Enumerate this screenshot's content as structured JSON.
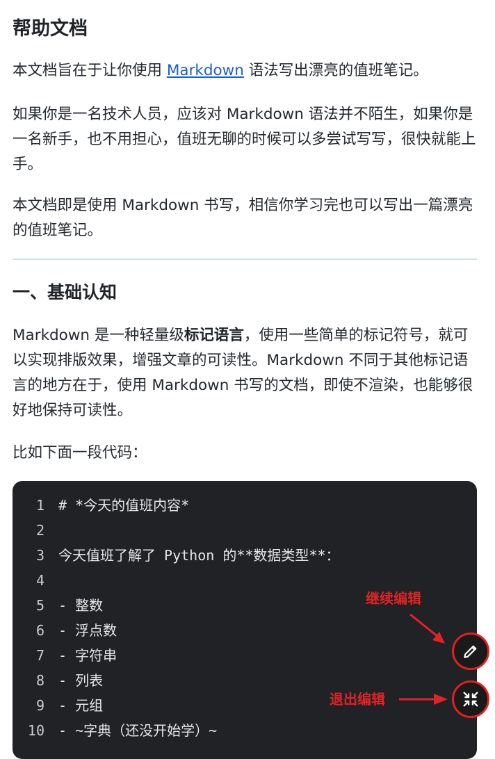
{
  "doc": {
    "title": "帮助文档",
    "intro_pre": "本文档旨在于让你使用 ",
    "intro_link": "Markdown",
    "intro_post": " 语法写出漂亮的值班笔记。",
    "para2": "如果你是一名技术人员，应该对 Markdown 语法并不陌生，如果你是一名新手，也不用担心，值班无聊的时候可以多尝试写写，很快就能上手。",
    "para3": "本文档即是使用 Markdown 书写，相信你学习完也可以写出一篇漂亮的值班笔记。"
  },
  "section1": {
    "title": "一、基础认知",
    "para1_pre": "Markdown 是一种轻量级",
    "para1_bold": "标记语言",
    "para1_post": "，使用一些简单的标记符号，就可以实现排版效果，增强文章的可读性。Markdown 不同于其他标记语言的地方在于，使用 Markdown 书写的文档，即使不渲染，也能够很好地保持可读性。",
    "para2": "比如下面一段代码："
  },
  "code": {
    "lines": [
      {
        "no": "1",
        "text": "# *今天的值班内容*"
      },
      {
        "no": "2",
        "text": ""
      },
      {
        "no": "3",
        "text": "今天值班了解了 Python 的**数据类型**："
      },
      {
        "no": "4",
        "text": ""
      },
      {
        "no": "5",
        "text": "- 整数"
      },
      {
        "no": "6",
        "text": "- 浮点数"
      },
      {
        "no": "7",
        "text": "- 字符串"
      },
      {
        "no": "8",
        "text": "- 列表"
      },
      {
        "no": "9",
        "text": "- 元组"
      },
      {
        "no": "10",
        "text": "- ~字典（还没开始学）~"
      }
    ]
  },
  "annotations": {
    "continue_edit": "继续编辑",
    "exit_edit": "退出编辑",
    "color": "#e02424"
  },
  "icons": {
    "edit": "pencil-icon",
    "exit": "collapse-icon"
  }
}
